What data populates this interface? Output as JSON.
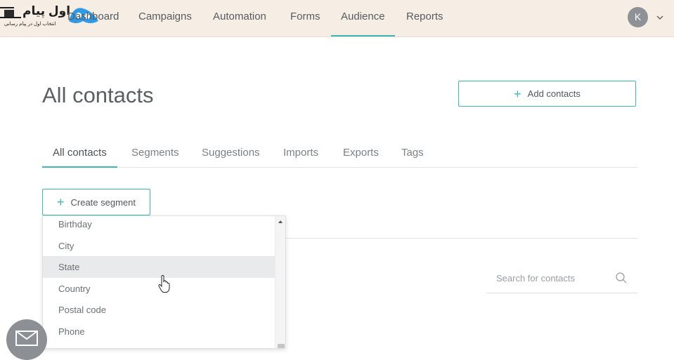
{
  "nav": {
    "logo_text": "اول پیام",
    "logo_subtext": "انتخاب اول در پیام رسانی",
    "items": [
      {
        "label": "Dashboard"
      },
      {
        "label": "Campaigns"
      },
      {
        "label": "Automation"
      },
      {
        "label": "Forms"
      },
      {
        "label": "Audience"
      },
      {
        "label": "Reports"
      }
    ],
    "active": "Audience",
    "avatar_initial": "K"
  },
  "page": {
    "title": "All contacts",
    "add_button_label": "Add contacts"
  },
  "tabs": [
    {
      "label": "All contacts"
    },
    {
      "label": "Segments"
    },
    {
      "label": "Suggestions"
    },
    {
      "label": "Imports"
    },
    {
      "label": "Exports"
    },
    {
      "label": "Tags"
    }
  ],
  "active_tab": "All contacts",
  "segment": {
    "button_label": "Create segment",
    "options": [
      {
        "label": "Birthday"
      },
      {
        "label": "City"
      },
      {
        "label": "State"
      },
      {
        "label": "Country"
      },
      {
        "label": "Postal code"
      },
      {
        "label": "Phone"
      }
    ],
    "highlighted": "State"
  },
  "search": {
    "placeholder": "Search for contacts"
  },
  "colors": {
    "accent": "#3fb6b8",
    "nav_bg": "#f6eee4",
    "logo_blue": "#2f9be6"
  }
}
